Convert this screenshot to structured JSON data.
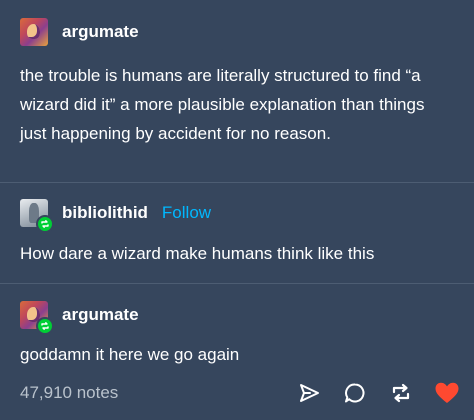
{
  "posts": [
    {
      "username": "argumate",
      "text": "the trouble is humans are literally structured to find “a wizard did it” a more plausible explanation than things just happening by accident for no reason."
    },
    {
      "username": "bibliolithid",
      "follow_label": "Follow",
      "text": "How dare a wizard make humans think like this"
    },
    {
      "username": "argumate",
      "text": "goddamn it here we go again"
    }
  ],
  "footer": {
    "notes": "47,910 notes"
  },
  "icons": {
    "share": "send-icon",
    "reply": "reply-icon",
    "reblog": "reblog-icon",
    "like": "heart-icon"
  },
  "colors": {
    "background": "#36465d",
    "link": "#00b8ff",
    "reblog_badge": "#00cf35",
    "heart": "#ff4930"
  }
}
